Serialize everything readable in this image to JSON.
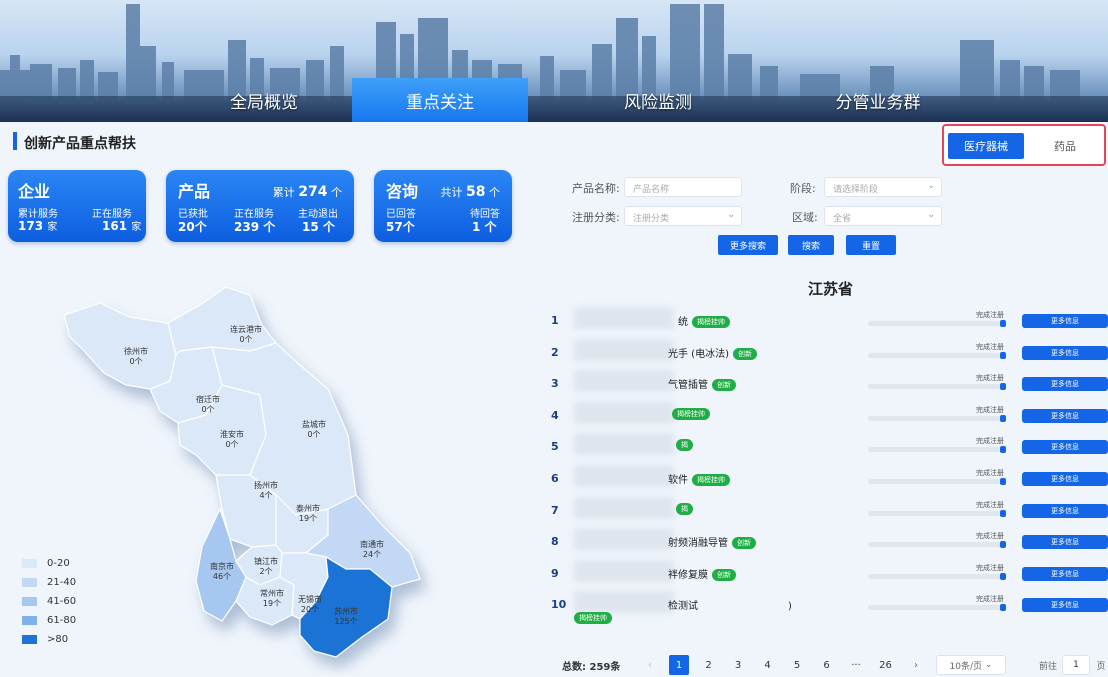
{
  "nav": {
    "tabs": [
      "全局概览",
      "重点关注",
      "风险监测",
      "分管业务群"
    ],
    "active": "重点关注"
  },
  "section": {
    "title": "创新产品重点帮扶"
  },
  "type_tabs": {
    "device": "医疗器械",
    "drug": "药品"
  },
  "cards": {
    "enterprise": {
      "title": "企业",
      "cum_label": "累计服务",
      "cum_value": "173",
      "cum_unit": "家",
      "active_label": "正在服务",
      "active_value": "161",
      "active_unit": "家"
    },
    "product": {
      "title": "产品",
      "total_label": "累计",
      "total_value": "274",
      "total_unit": "个",
      "approved_label": "已获批",
      "approved_value": "20个",
      "serving_label": "正在服务",
      "serving_value": "239 个",
      "exit_label": "主动退出",
      "exit_value": "15 个"
    },
    "consult": {
      "title": "咨询",
      "total_label": "共计",
      "total_value": "58",
      "total_unit": "个",
      "replied_label": "已回答",
      "replied_value": "57个",
      "pending_label": "待回答",
      "pending_value": "1 个"
    }
  },
  "filters": {
    "name_label": "产品名称:",
    "name_placeholder": "产品名称",
    "stage_label": "阶段:",
    "stage_placeholder": "请选择阶段",
    "category_label": "注册分类:",
    "category_placeholder": "注册分类",
    "region_label": "区域:",
    "region_placeholder": "全省",
    "more_btn": "更多搜索",
    "search_btn": "搜索",
    "reset_btn": "重置"
  },
  "province": "江苏省",
  "map": {
    "cities": [
      {
        "name": "连云港市",
        "count": "0个"
      },
      {
        "name": "徐州市",
        "count": "0个"
      },
      {
        "name": "宿迁市",
        "count": "0个"
      },
      {
        "name": "淮安市",
        "count": "0个"
      },
      {
        "name": "盐城市",
        "count": "0个"
      },
      {
        "name": "扬州市",
        "count": "4个"
      },
      {
        "name": "泰州市",
        "count": "19个"
      },
      {
        "name": "南通市",
        "count": "24个"
      },
      {
        "name": "南京市",
        "count": "46个"
      },
      {
        "name": "镇江市",
        "count": "2个"
      },
      {
        "name": "常州市",
        "count": "19个"
      },
      {
        "name": "无锡市",
        "count": "20个"
      },
      {
        "name": "苏州市",
        "count": "125个"
      }
    ],
    "legend": [
      {
        "label": "0-20",
        "color": "#dbe8f8"
      },
      {
        "label": "21-40",
        "color": "#c2d8f4"
      },
      {
        "label": "41-60",
        "color": "#a6c7f0"
      },
      {
        "label": "61-80",
        "color": "#7fb0ea"
      },
      {
        "label": ">80",
        "color": "#1f73d6"
      }
    ]
  },
  "products": [
    {
      "no": "1",
      "name": "统",
      "badge": "揭榜挂帅",
      "stage": "完成注册",
      "more": "更多信息"
    },
    {
      "no": "2",
      "name": "光手 (电冰法)",
      "badge": "创新",
      "stage": "完成注册",
      "more": "更多信息"
    },
    {
      "no": "3",
      "name": "气管插管",
      "badge": "创新",
      "stage": "完成注册",
      "more": "更多信息"
    },
    {
      "no": "4",
      "name": "",
      "badge": "揭榜挂帅",
      "stage": "完成注册",
      "more": "更多信息"
    },
    {
      "no": "5",
      "name": "",
      "badge": "揭",
      "stage": "完成注册",
      "more": "更多信息"
    },
    {
      "no": "6",
      "name": "软件",
      "badge": "揭榜挂帅",
      "stage": "完成注册",
      "more": "更多信息"
    },
    {
      "no": "7",
      "name": "",
      "badge": "揭",
      "stage": "完成注册",
      "more": "更多信息"
    },
    {
      "no": "8",
      "name": "射频消融导管",
      "badge": "创新",
      "stage": "完成注册",
      "more": "更多信息"
    },
    {
      "no": "9",
      "name": "袢修复膜",
      "badge": "创新",
      "stage": "完成注册",
      "more": "更多信息"
    },
    {
      "no": "10",
      "name": "检测试",
      "name_tail": ")",
      "badge": "揭榜挂帅",
      "stage": "完成注册",
      "more": "更多信息"
    }
  ],
  "pagination": {
    "total_label": "总数:",
    "total_value": "259条",
    "pages": [
      "1",
      "2",
      "3",
      "4",
      "5",
      "6",
      "···",
      "26"
    ],
    "prev": "‹",
    "next": "›",
    "page_size": "10条/页",
    "goto_label": "前往",
    "goto_value": "1",
    "goto_unit": "页"
  }
}
